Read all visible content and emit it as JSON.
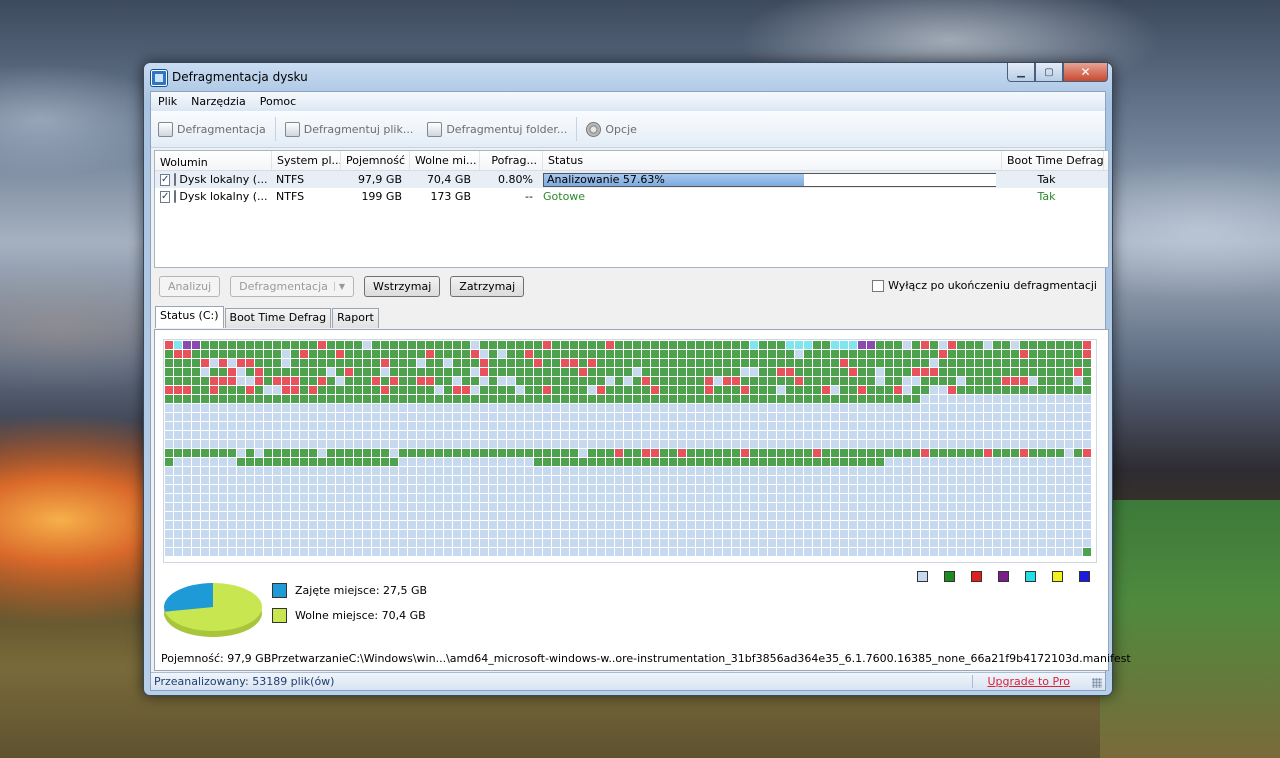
{
  "window": {
    "title": "Defragmentacja dysku"
  },
  "menu": [
    "Plik",
    "Narzędzia",
    "Pomoc"
  ],
  "toolbar": {
    "defrag": "Defragmentacja",
    "defrag_file": "Defragmentuj plik...",
    "defrag_folder": "Defragmentuj folder...",
    "options": "Opcje"
  },
  "volumes": {
    "headers": [
      "Wolumin",
      "System pl...",
      "Pojemność",
      "Wolne mi...",
      "Pofrag...",
      "Status",
      "Boot Time Defrag"
    ],
    "rows": [
      {
        "checked": true,
        "name": "Dysk lokalny (...",
        "fs": "NTFS",
        "capacity": "97,9 GB",
        "free": "70,4 GB",
        "fragmented": "0.80%",
        "status": "Analizowanie 57.63%",
        "progress": 0.5763,
        "boot": "Tak"
      },
      {
        "checked": true,
        "name": "Dysk lokalny (...",
        "fs": "NTFS",
        "capacity": "199 GB",
        "free": "173 GB",
        "fragmented": "--",
        "status": "Gotowe",
        "boot": "Tak"
      }
    ]
  },
  "actions": {
    "analyze": "Analizuj",
    "defrag": "Defragmentacja",
    "pause": "Wstrzymaj",
    "stop": "Zatrzymaj",
    "shutdown_label": "Wyłącz po ukończeniu defragmentacji"
  },
  "tabs": [
    "Status (C:)",
    "Boot Time Defrag",
    "Raport"
  ],
  "legend_colors": [
    "#c6d9ef",
    "#1f8a1f",
    "#e02020",
    "#7a1f8a",
    "#1fe0e8",
    "#f2f21a",
    "#1a1ae0"
  ],
  "disk_map_colors": {
    "free": "#c6d9ef",
    "used": "#4ea24e",
    "fragmented": "#e8525c",
    "purple": "#8a4ab0",
    "cyan": "#7fe6f0"
  },
  "usage": {
    "used_label": "Zajęte miejsce: 27,5 GB",
    "free_label": "Wolne miejsce: 70,4 GB",
    "used_color": "#1e9ad6",
    "free_color": "#c8e650",
    "used_fraction": 0.281
  },
  "info": {
    "capacity": "Pojemność: 97,9 GB",
    "processing": "Przetwarzanie",
    "path": "C:\\Windows\\win...\\amd64_microsoft-windows-w..ore-instrumentation_31bf3856ad364e35_6.1.7600.16385_none_66a21f9b4172103d.manifest"
  },
  "statusbar": {
    "analyzed": "Przeanalizowany: 53189 plik(ów)",
    "upgrade": "Upgrade to Pro"
  }
}
